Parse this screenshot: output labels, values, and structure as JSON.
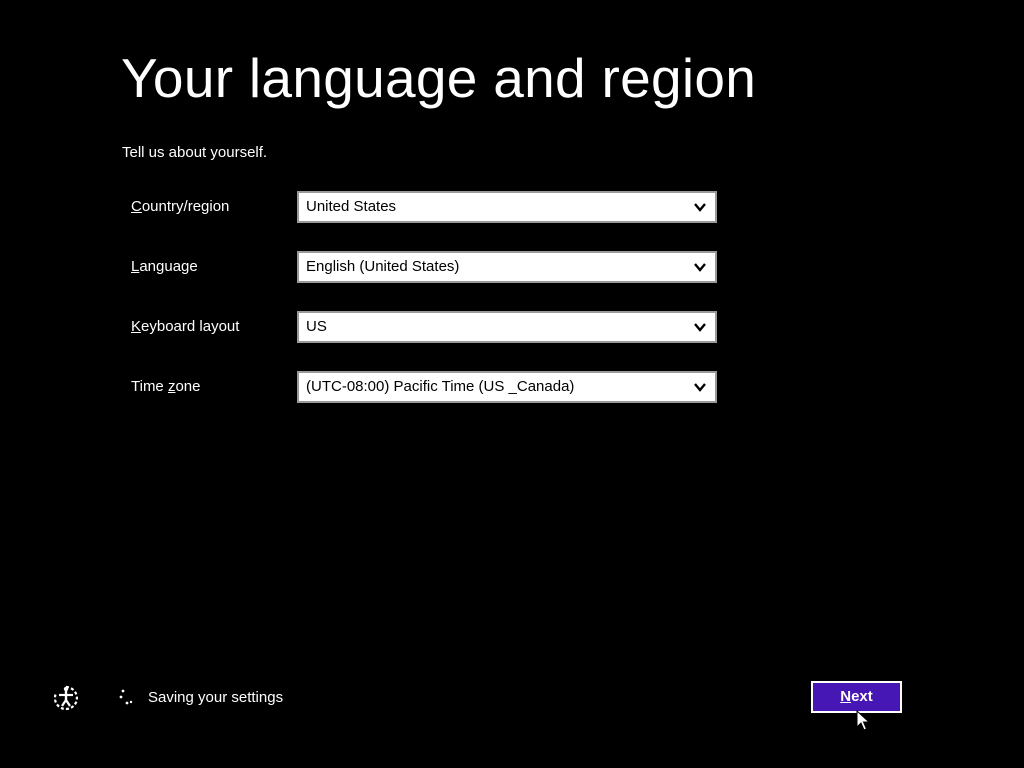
{
  "page": {
    "title": "Your language and region",
    "subtitle": "Tell us about yourself."
  },
  "fields": [
    {
      "label_accel": "C",
      "label_rest": "ountry/region",
      "value": "United States"
    },
    {
      "label_accel": "L",
      "label_rest": "anguage",
      "value": "English (United States)"
    },
    {
      "label_accel": "K",
      "label_rest": "eyboard layout",
      "value": "US"
    },
    {
      "label_pre": "Time ",
      "label_accel": "z",
      "label_rest": "one",
      "value": "(UTC-08:00) Pacific Time (US _Canada)"
    }
  ],
  "footer": {
    "status_text": "Saving your settings",
    "next_accel": "N",
    "next_rest": "ext"
  },
  "icons": {
    "accessibility": "ease-of-access-icon",
    "progress": "progress-spinner-icon",
    "dropdown": "chevron-down-icon",
    "pointer": "mouse-pointer-icon"
  },
  "colors": {
    "background": "#000000",
    "accent": "#4617b4",
    "text": "#ffffff",
    "field_border": "#9a9a9a"
  }
}
